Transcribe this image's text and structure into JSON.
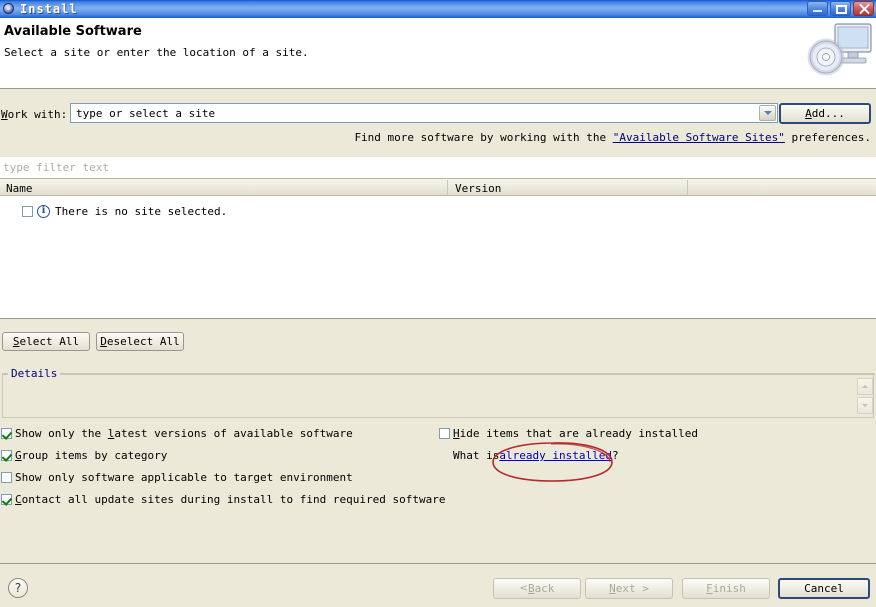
{
  "window": {
    "title": "Install",
    "icon": "install-disc-icon",
    "controls": {
      "minimize": "Minimize",
      "maximize": "Maximize",
      "close": "Close"
    }
  },
  "banner": {
    "title": "Available Software",
    "subtitle": "Select a site or enter the location of a site.",
    "image": "cd-monitor-icon"
  },
  "work_with": {
    "label_pre": "W",
    "label_post": "ork with:",
    "value": "type or select a site",
    "dropdown_icon": "chevron-down-icon",
    "add_button_pre": "A",
    "add_button_post": "dd..."
  },
  "find_more": {
    "prefix": "Find more software by working with the ",
    "link": "\"Available Software Sites\"",
    "suffix": " preferences."
  },
  "filter": {
    "placeholder": "type filter text"
  },
  "table": {
    "columns": [
      {
        "label": "Name"
      },
      {
        "label": "Version"
      },
      {
        "label": ""
      }
    ],
    "rows": [
      {
        "checked": false,
        "icon": "info-icon",
        "name": "There is no site selected.",
        "version": ""
      }
    ]
  },
  "selection_buttons": {
    "select_all_pre": "S",
    "select_all_post": "elect All",
    "deselect_all_pre": "D",
    "deselect_all_post": "eselect All"
  },
  "details": {
    "group_label": "Details",
    "scroll_up_icon": "scroll-up-icon",
    "scroll_down_icon": "scroll-down-icon"
  },
  "options": {
    "left": [
      {
        "checked": true,
        "pre": "Show only the ",
        "mn": "l",
        "post": "atest versions of available software"
      },
      {
        "checked": true,
        "pre": "",
        "mn": "G",
        "post": "roup items by category"
      },
      {
        "checked": false,
        "pre": "Show only software applicable to target environment",
        "mn": "",
        "post": ""
      },
      {
        "checked": true,
        "pre": "",
        "mn": "C",
        "post": "ontact all update sites during install to find required software"
      }
    ],
    "right": {
      "hide_installed": {
        "checked": false,
        "pre": "",
        "mn": "H",
        "post": "ide items that are already installed"
      },
      "what_is_prefix": "What is ",
      "what_is_link": "already installed",
      "what_is_suffix": "?"
    }
  },
  "annotation": {
    "shape": "red-ellipse-highlight",
    "color": "#b22a2a"
  },
  "footer": {
    "help_label": "?",
    "back_pre": "< ",
    "back_mn": "B",
    "back_post": "ack",
    "next_pre": "",
    "next_mn": "N",
    "next_post": "ext >",
    "finish_pre": "",
    "finish_mn": "F",
    "finish_post": "inish",
    "cancel": "Cancel"
  },
  "colors": {
    "dialog_bg": "#ece9d8",
    "title_blue": "#3a7ae0",
    "link_blue": "#0000cc",
    "nav_link": "#000080",
    "annotation_red": "#b22a2a",
    "check_green": "#107c10"
  }
}
